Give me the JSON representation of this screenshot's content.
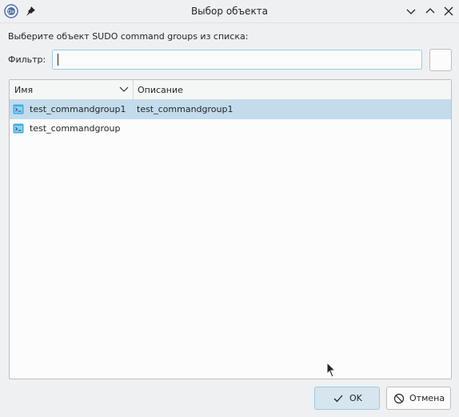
{
  "window": {
    "title": "Выбор объекта",
    "icons": {
      "app": "dx-app-icon",
      "pin": "pin-icon",
      "minimize": "chevron-down-icon",
      "maximize": "chevron-up-icon",
      "close": "close-icon"
    }
  },
  "prompt": "Выберите объект SUDO command groups из списка:",
  "filter": {
    "label": "Фильтр:",
    "value": "",
    "placeholder": ""
  },
  "list": {
    "columns": {
      "name": "Имя",
      "description": "Описание"
    },
    "rows": [
      {
        "name": "test_commandgroup1",
        "description": "test_commandgroup1",
        "selected": true,
        "icon": "command-group-icon"
      },
      {
        "name": "test_commandgroup",
        "description": "",
        "selected": false,
        "icon": "command-group-icon"
      }
    ]
  },
  "buttons": {
    "ok": "OK",
    "cancel": "Отмена"
  },
  "colors": {
    "accent": "#3daee9",
    "selection": "#c2dcec",
    "background": "#eff0f1"
  }
}
